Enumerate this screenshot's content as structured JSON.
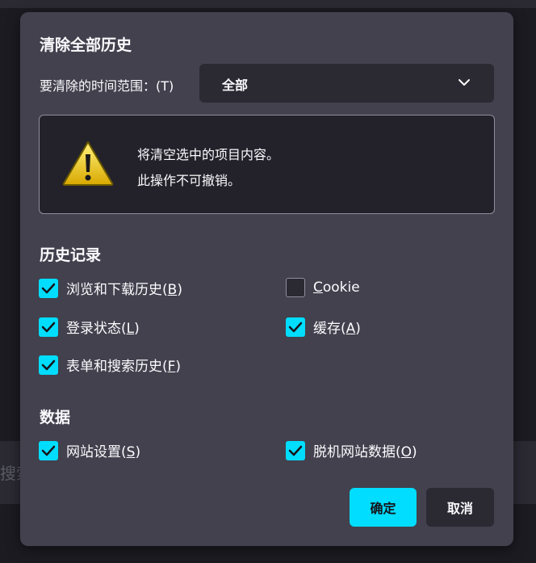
{
  "background": {
    "search_fragment": "搜索"
  },
  "dialog": {
    "title": "清除全部历史",
    "time_range": {
      "label": "要清除的时间范围：(T)",
      "selected": "全部",
      "chevron_icon": "chevron-down-icon"
    },
    "warning": {
      "icon": "warning-icon",
      "line1": "将清空选中的项目内容。",
      "line2": "此操作不可撤销。"
    },
    "history_section": {
      "heading": "历史记录",
      "items": [
        {
          "text": "浏览和下载历史(",
          "key": "B",
          "suffix": ")",
          "checked": true
        },
        {
          "text": "",
          "key": "C",
          "suffix": "ookie",
          "checked": false
        },
        {
          "text": "登录状态(",
          "key": "L",
          "suffix": ")",
          "checked": true
        },
        {
          "text": "缓存(",
          "key": "A",
          "suffix": ")",
          "checked": true
        },
        {
          "text": "表单和搜索历史(",
          "key": "F",
          "suffix": ")",
          "checked": true
        }
      ]
    },
    "data_section": {
      "heading": "数据",
      "items": [
        {
          "text": "网站设置(",
          "key": "S",
          "suffix": ")",
          "checked": true
        },
        {
          "text": "脱机网站数据(",
          "key": "O",
          "suffix": ")",
          "checked": true
        }
      ]
    },
    "buttons": {
      "ok": "确定",
      "cancel": "取消"
    },
    "colors": {
      "accent": "#00ddff",
      "dialog_bg": "#42414d",
      "field_bg": "#2b2a33"
    }
  }
}
